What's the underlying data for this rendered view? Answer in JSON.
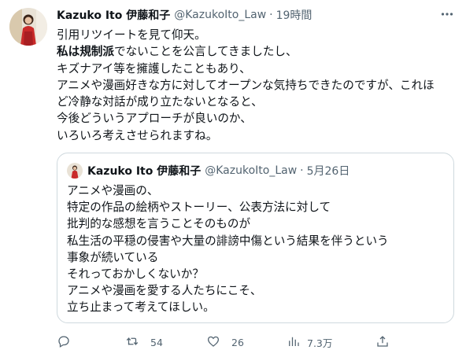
{
  "tweet": {
    "author_name": "Kazuko Ito 伊藤和子",
    "author_handle": "@KazukoIto_Law",
    "separator": "·",
    "time": "19時間",
    "lines": [
      {
        "bold": "",
        "text": "引用リツイートを見て仰天。"
      },
      {
        "bold": "私は規制派",
        "text": "でないことを公言してきましたし、"
      },
      {
        "bold": "",
        "text": "キズナアイ等を擁護したこともあり、"
      },
      {
        "bold": "",
        "text": "アニメや漫画好きな方に対してオープンな気持ちできたのですが、これほ"
      },
      {
        "bold": "",
        "text": "ど冷静な対話が成り立たないとなると、"
      },
      {
        "bold": "",
        "text": "今後どういうアプローチが良いのか、"
      },
      {
        "bold": "",
        "text": "いろいろ考えさせられますね。"
      }
    ]
  },
  "quote": {
    "author_name": "Kazuko Ito 伊藤和子",
    "author_handle": "@KazukoIto_Law",
    "separator": "·",
    "date": "5月26日",
    "lines": [
      "アニメや漫画の、",
      "特定の作品の絵柄やストーリー、公表方法に対して",
      "批判的な感想を言うことそのものが",
      "私生活の平穏の侵害や大量の誹謗中傷という結果を伴うという",
      "事象が続いている",
      "それっておかしくないか？",
      "アニメや漫画を愛する人たちにこそ、",
      "立ち止まって考えてほしい。"
    ]
  },
  "actions": {
    "reply_count": "",
    "retweet_count": "54",
    "like_count": "26",
    "views_count": "7.3万",
    "icons": [
      "reply-icon",
      "retweet-icon",
      "like-icon",
      "views-icon",
      "share-icon"
    ]
  },
  "colors": {
    "text": "#0f1419",
    "secondary": "#536471",
    "border": "#cfd9de"
  }
}
